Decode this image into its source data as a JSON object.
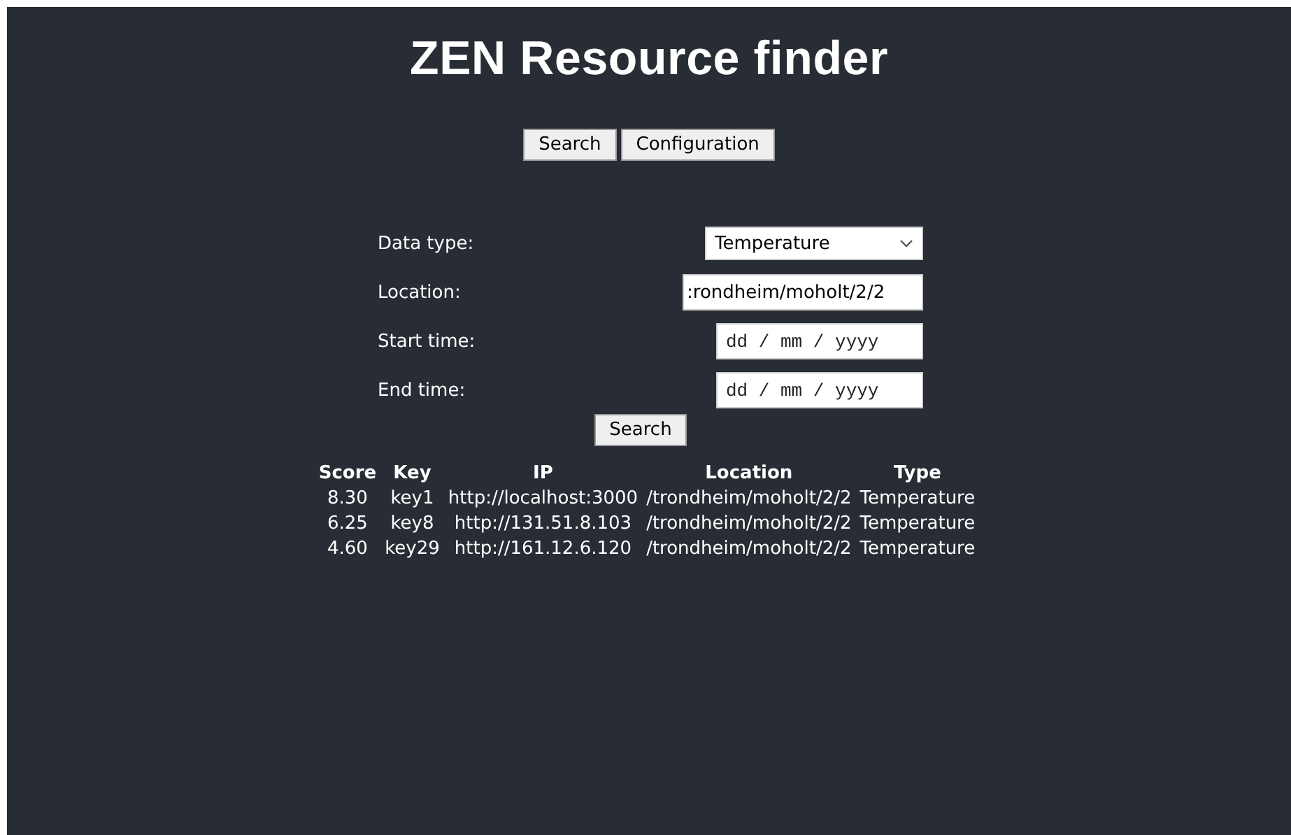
{
  "title": "ZEN Resource finder",
  "nav_buttons": [
    "Search",
    "Configuration"
  ],
  "form": {
    "data_type": {
      "label": "Data type:",
      "value": "Temperature"
    },
    "location": {
      "label": "Location:",
      "value": ":rondheim/moholt/2/2"
    },
    "start_time": {
      "label": "Start time:",
      "placeholder": "dd / mm / yyyy"
    },
    "end_time": {
      "label": "End time:",
      "placeholder": "dd / mm / yyyy"
    },
    "submit": "Search"
  },
  "table": {
    "columns": [
      "Score",
      "Key",
      "IP",
      "Location",
      "Type"
    ],
    "rows": [
      [
        "8.30",
        "key1",
        "http://localhost:3000",
        "/trondheim/moholt/2/2",
        "Temperature"
      ],
      [
        "6.25",
        "key8",
        "http://131.51.8.103",
        "/trondheim/moholt/2/2",
        "Temperature"
      ],
      [
        "4.60",
        "key29",
        "http://161.12.6.120",
        "/trondheim/moholt/2/2",
        "Temperature"
      ]
    ]
  }
}
